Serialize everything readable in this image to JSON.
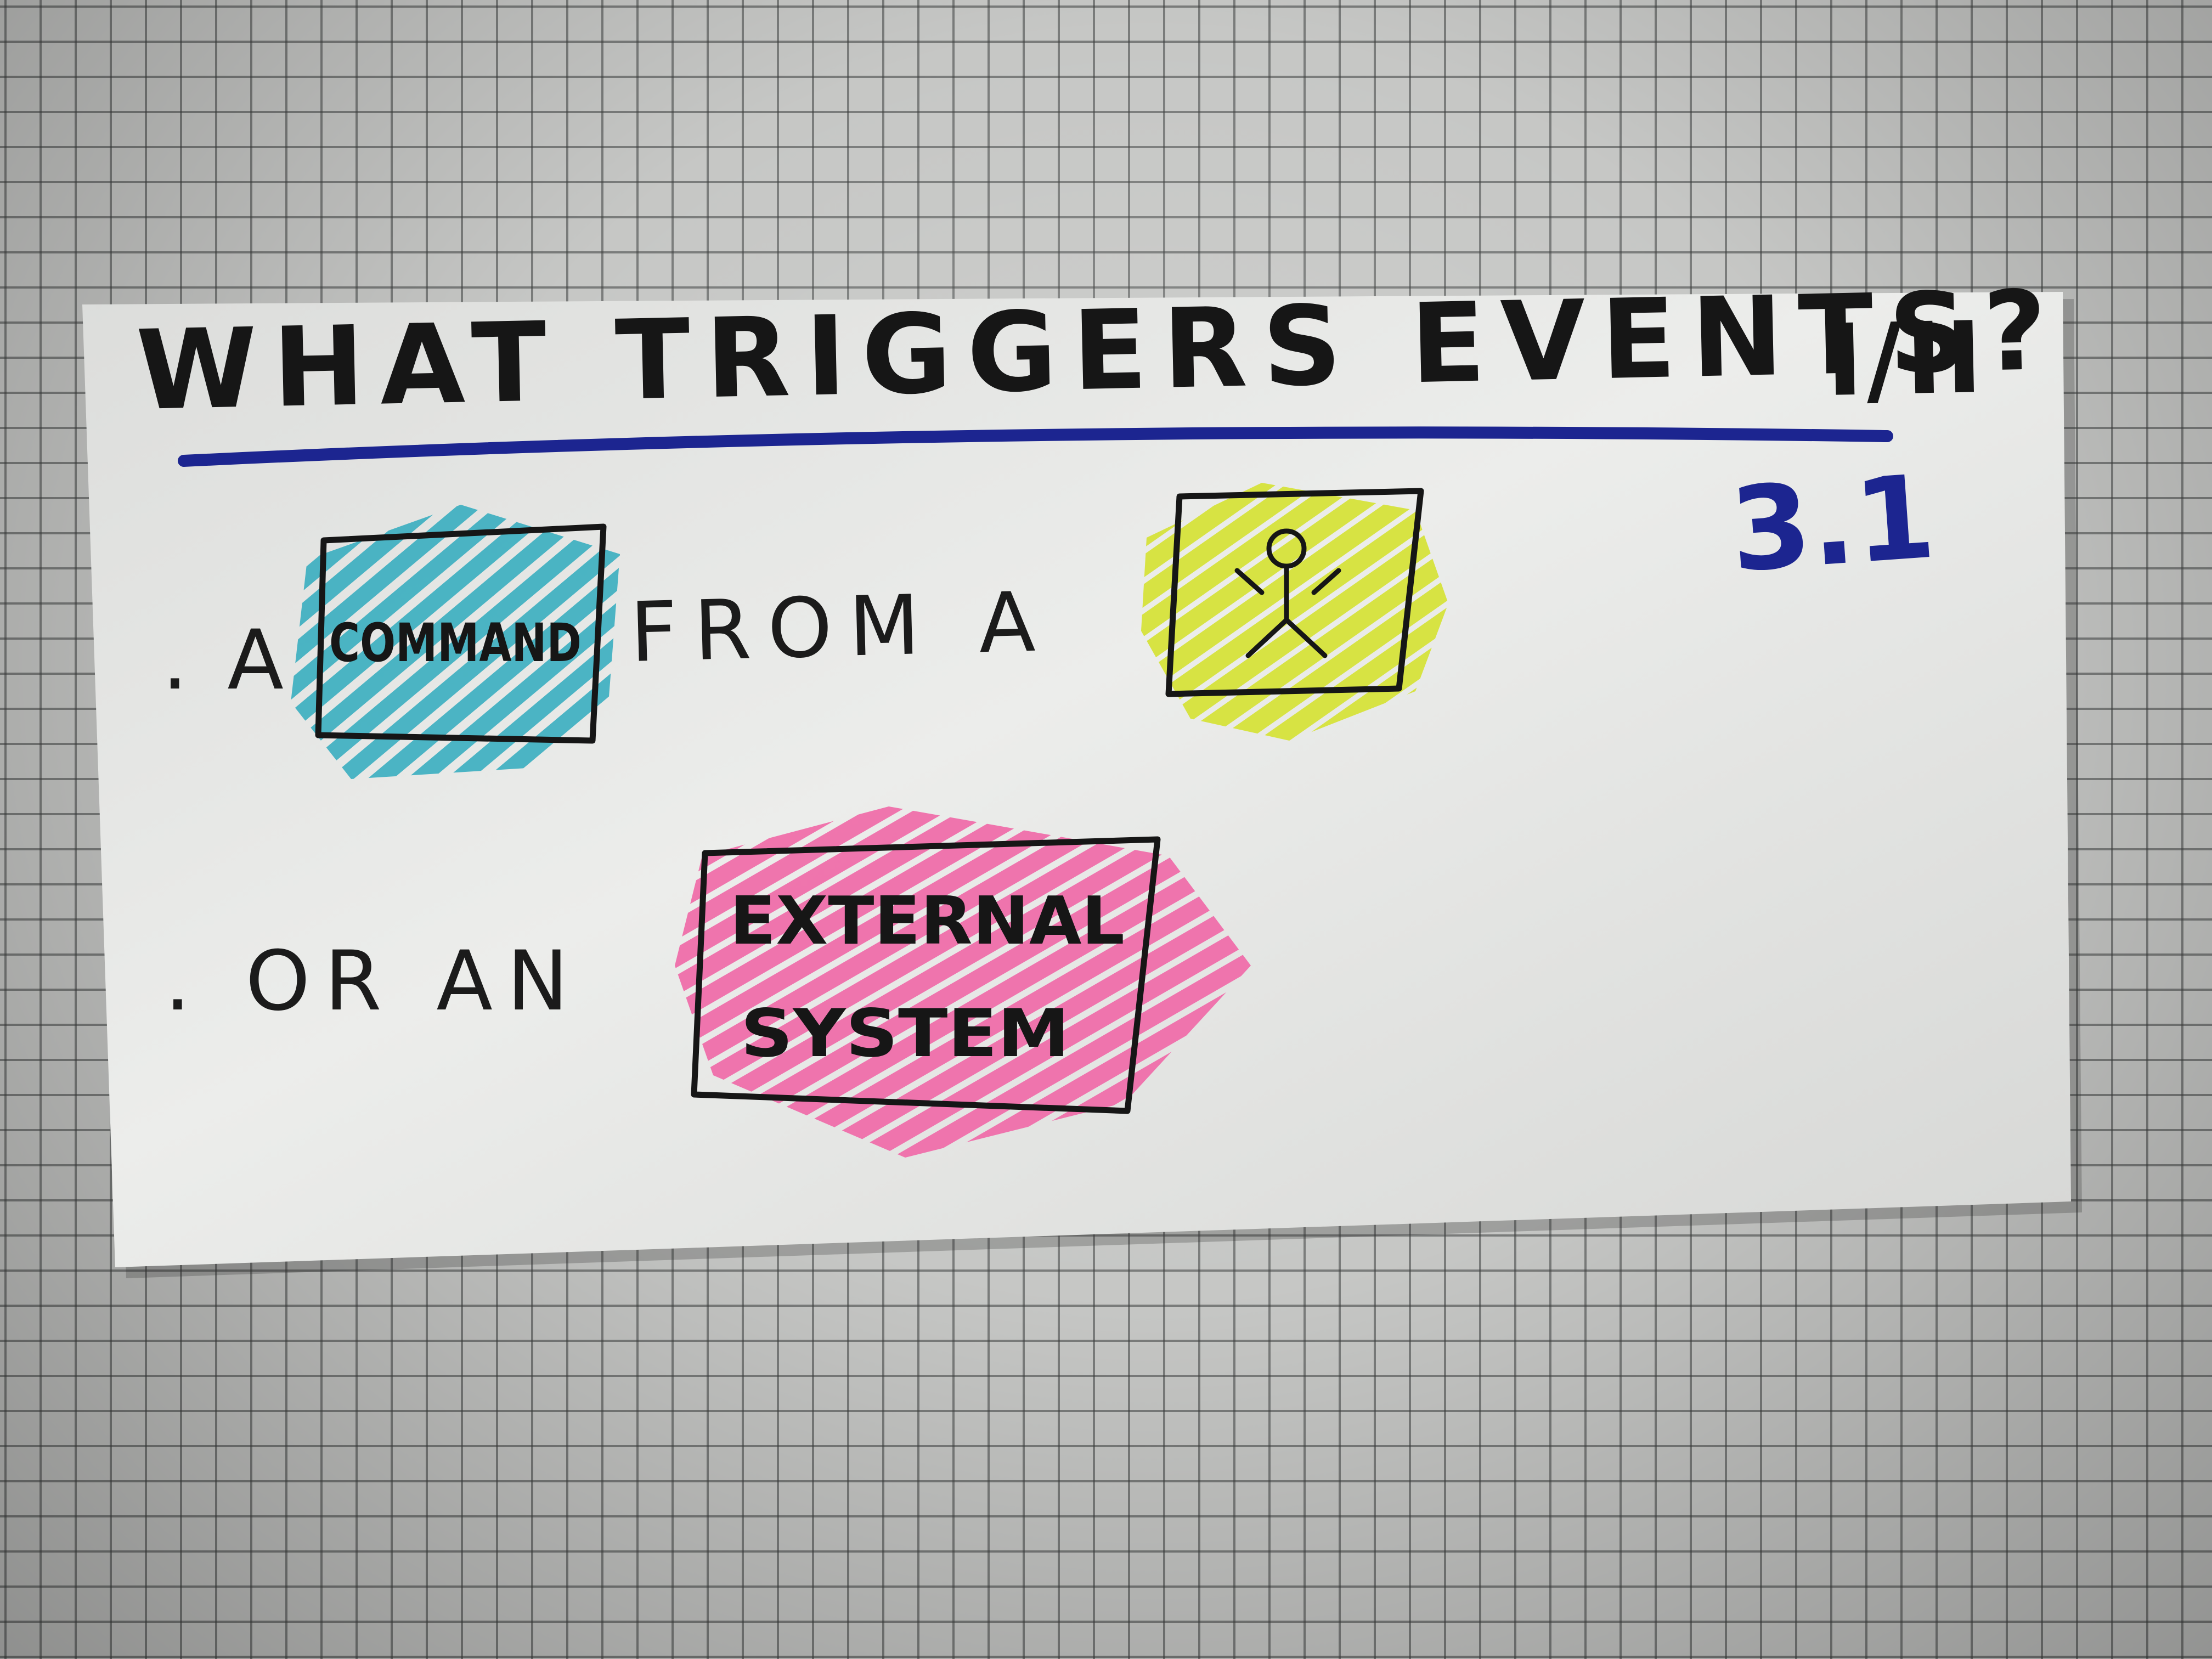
{
  "card": {
    "title": "WHAT TRIGGERS EVENTS?",
    "part_marker": "I/II",
    "section_number": "3.1",
    "line_one_prefix": ". A",
    "command_label": "COMMAND",
    "line_one_middle": "FROM A",
    "line_two_prefix": ". OR AN",
    "external_label_line1": "EXTERNAL",
    "external_label_line2": "SYSTEM"
  },
  "colors": {
    "card_paper": "#e9eae8",
    "ink_black": "#161616",
    "ink_blue": "#1c2590",
    "highlight_cyan": "#3aaec0",
    "highlight_yellow": "#d6e23a",
    "highlight_pink": "#f06aa8",
    "grid_background": "#c6c7c5"
  },
  "icons": {
    "person": "stick-figure-icon"
  }
}
